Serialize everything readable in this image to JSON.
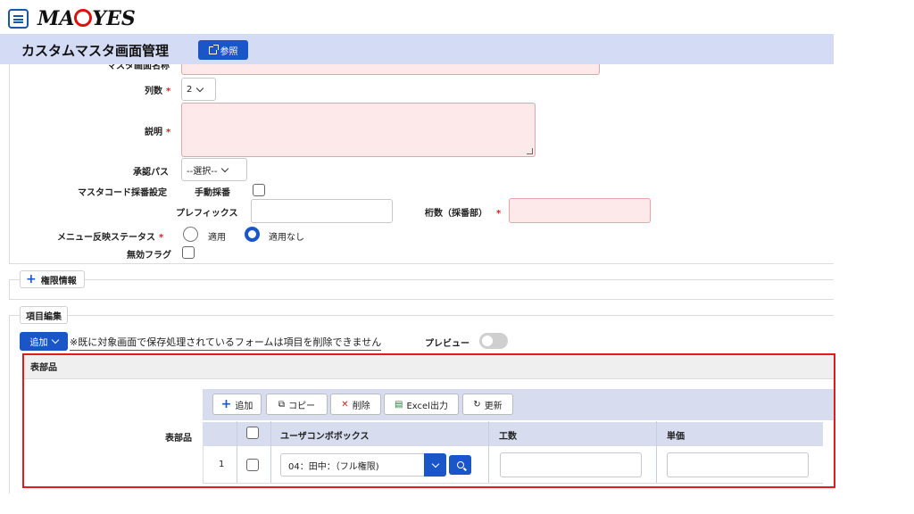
{
  "header": {
    "logo": "MAEYES",
    "page_title": "カスタムマスタ画面管理",
    "ref_button": "参照"
  },
  "form": {
    "truncated_label": "マスタ画面名称",
    "columns_label": "列数",
    "columns_value": "2",
    "description_label": "説明",
    "approval_label": "承認パス",
    "approval_value": "--選択--",
    "master_code_label": "マスタコード採番設定",
    "manual_label": "手動採番",
    "prefix_label": "プレフィックス",
    "digits_label": "桁数（採番部）",
    "menu_status_label": "メニュー反映ステータス",
    "apply_label": "適用",
    "no_apply_label": "適用なし",
    "invalid_label": "無効フラグ",
    "required_mark": "*"
  },
  "sections": {
    "permission_tab": "権限情報",
    "item_edit_tab": "項目編集"
  },
  "item_edit": {
    "add_button": "追加",
    "notice": "※既に対象画面で保存処理されているフォームは項目を削除できません",
    "preview_label": "プレビュー",
    "band_title": "表部品",
    "row_label": "表部品"
  },
  "grid": {
    "toolbar": {
      "add": "追加",
      "copy": "コピー",
      "delete": "削除",
      "excel": "Excel出力",
      "refresh": "更新"
    },
    "columns": [
      "ユーザコンボボックス",
      "工数",
      "単価"
    ],
    "rows": [
      {
        "no": "1",
        "user": "04：田中：（フル権限)"
      }
    ]
  },
  "colors": {
    "accent": "#1a56c8",
    "title_bar": "#d4dbf4",
    "required": "#d22222",
    "highlight": "#e21a1a"
  }
}
